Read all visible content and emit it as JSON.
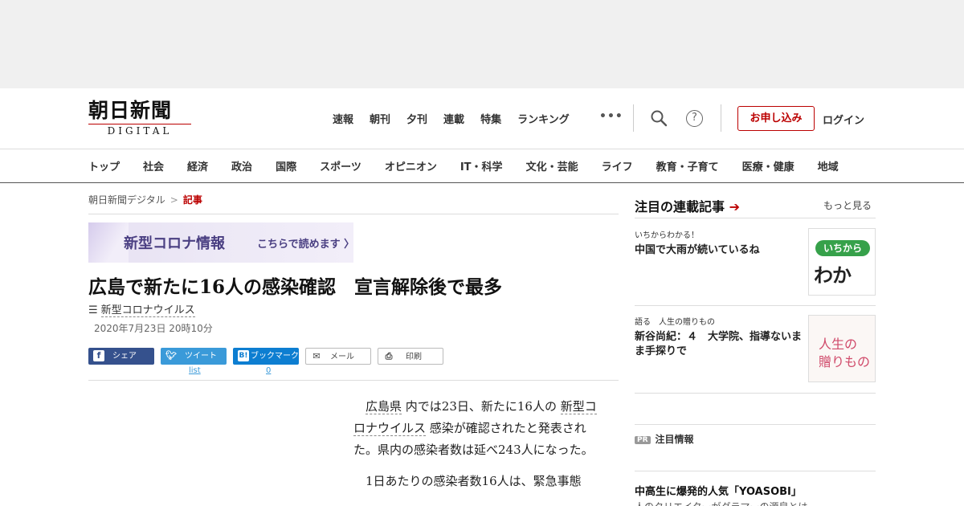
{
  "header": {
    "logo_jp": "朝日新聞",
    "logo_en": "DIGITAL",
    "top_nav": [
      "速報",
      "朝刊",
      "夕刊",
      "連載",
      "特集",
      "ランキング"
    ],
    "more_label": "•••",
    "apply_label": "お申し込み",
    "login_label": "ログイン"
  },
  "category_nav": [
    "トップ",
    "社会",
    "経済",
    "政治",
    "国際",
    "スポーツ",
    "オピニオン",
    "IT・科学",
    "文化・芸能",
    "ライフ",
    "教育・子育て",
    "医療・健康",
    "地域"
  ],
  "breadcrumb": {
    "home": "朝日新聞デジタル",
    "separator": ">",
    "current": "記事"
  },
  "banner": {
    "title": "新型コロナ情報",
    "link": "こちらで読めます 〉"
  },
  "article": {
    "headline": "広島で新たに16人の感染確認　宣言解除後で最多",
    "tag": "新型コロナウイルス",
    "date": "2020年7月23日 20時10分",
    "p1_link1": "広島県",
    "p1_text1": "内では23日、新たに16人の",
    "p1_link2": "新型コロナウイルス",
    "p1_text2": "感染が確認されたと発表された。県内の感染者数は延べ243人になった。",
    "p2": "1日あたりの感染者数16人は、緊急事態"
  },
  "share": {
    "facebook": "シェア",
    "twitter": "ツイート",
    "hatena": "ブックマーク",
    "mail": "メール",
    "print": "印刷",
    "twitter_count": "list",
    "hatena_count": "0"
  },
  "sidebar": {
    "heading": "注目の連載記事",
    "more": "もっと見る",
    "items": [
      {
        "kicker": "いちからわかる！",
        "title": "中国で大雨が続いているね",
        "thumb_top": "いちから",
        "thumb_main": "わかる",
        "thumb_bang": "!"
      },
      {
        "kicker": "語る　人生の贈りもの",
        "title": "新谷尚紀：４　大学院、指導ないまま手探りで",
        "thumb_l1": "人生の",
        "thumb_l2": "贈りもの"
      }
    ],
    "pr_badge": "PR",
    "pr_heading": "注目情報",
    "pr_title": "中高生に爆発的人気「YOASOBI」",
    "pr_sub": "人のクリエイターがグラマーの源泉とは"
  },
  "colors": {
    "brand_red": "#bb0000",
    "facebook": "#35518d",
    "twitter": "#3a9ad9",
    "hatena": "#0d7ed1",
    "corona_purple": "#4a3f82"
  }
}
